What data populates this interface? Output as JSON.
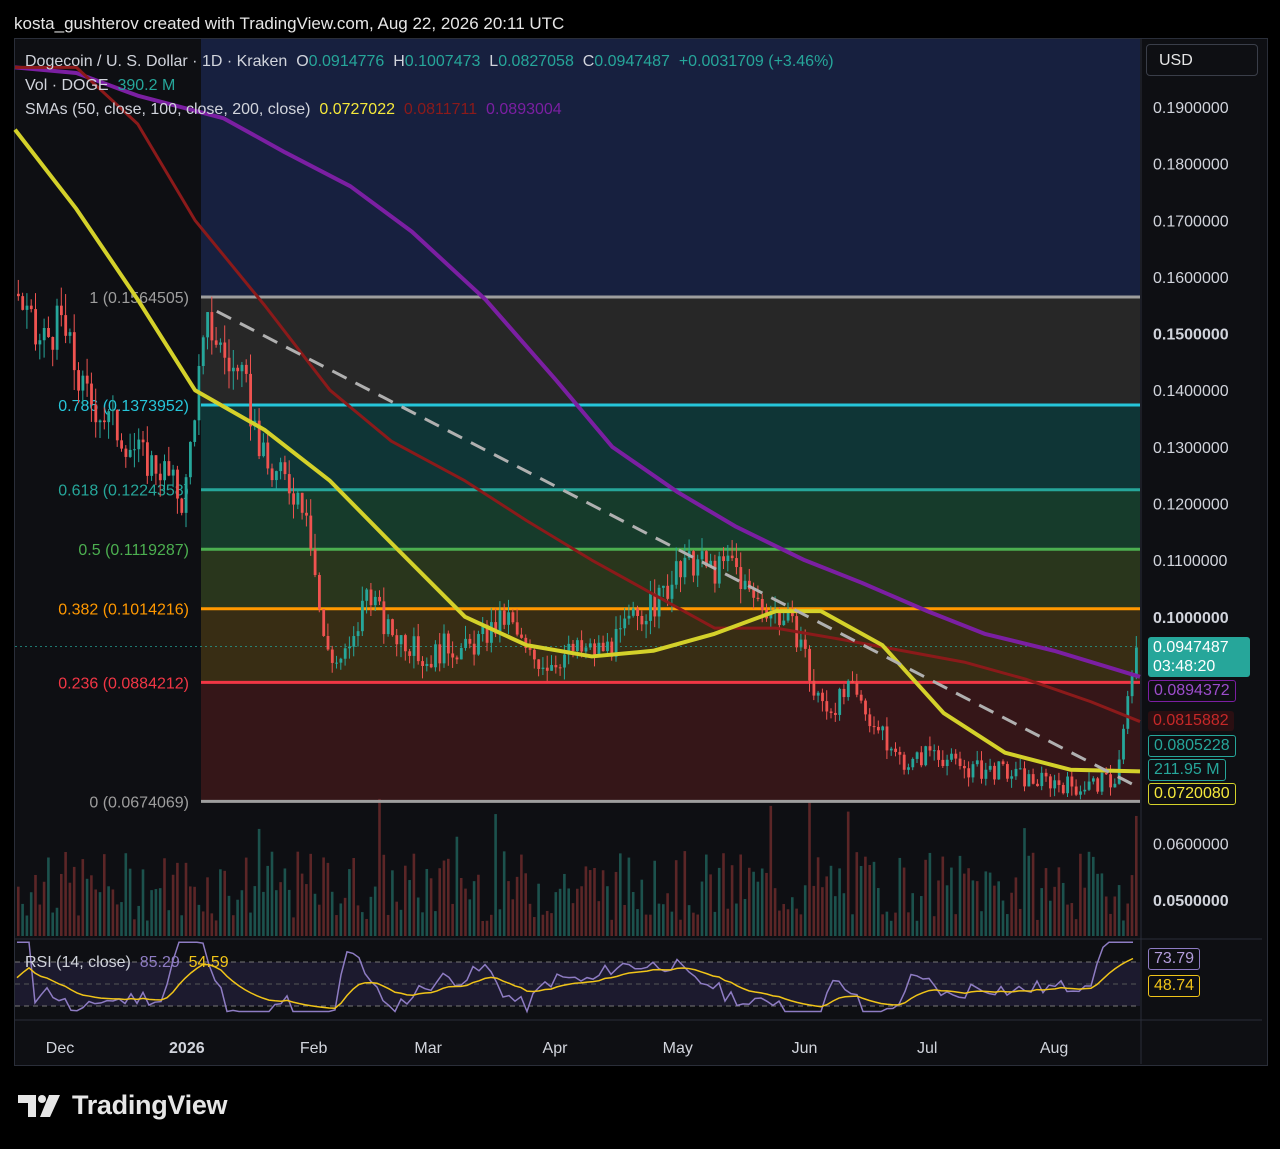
{
  "credit": "kosta_gushterov created with TradingView.com, Aug 22, 2026 20:11 UTC",
  "legend": {
    "symbol": "Dogecoin / U. S. Dollar · 1D · Kraken",
    "open_label": "O",
    "open": "0.0914776",
    "high_label": "H",
    "high": "0.1007473",
    "low_label": "L",
    "low": "0.0827058",
    "close_label": "C",
    "close": "0.0947487",
    "change": "+0.0031709 (+3.46%)",
    "vol_label": "Vol · DOGE",
    "vol": "390.2 M",
    "sma_label": "SMAs (50, close, 100, close, 200, close)",
    "sma50": "0.0727022",
    "sma100": "0.0811711",
    "sma200": "0.0893004"
  },
  "currency": "USD",
  "labels": {
    "current_price": "0.0947487",
    "countdown": "03:48:20",
    "sma200_tag": "0.0894372",
    "sma100_tag": "0.0815882",
    "level_tag": "0.0805228",
    "volume_tag": "211.95 M",
    "sma50_tag": "0.0720080"
  },
  "rsi": {
    "title": "RSI (14, close)",
    "value": "85.29",
    "ma": "54.59",
    "tag1": "73.79",
    "tag2": "48.74"
  },
  "brand": "TradingView",
  "colors": {
    "up": "#26a69a",
    "down": "#ef5350",
    "sma50": "#d4d12a",
    "sma100": "#8b1a1a",
    "sma200": "#7b1fa2",
    "rsi": "#8e7cc3",
    "rsi_ma": "#f0c419"
  },
  "chart_data": {
    "type": "candlestick",
    "symbol": "Dogecoin / U. S. Dollar",
    "interval": "1D",
    "exchange": "Kraken",
    "y_axis_ticks": [
      0.19,
      0.18,
      0.17,
      0.16,
      0.15,
      0.14,
      0.13,
      0.12,
      0.11,
      0.1,
      0.06,
      0.05
    ],
    "y_axis_tick_labels": [
      "0.1900000",
      "0.1800000",
      "0.1700000",
      "0.1600000",
      "0.1500000",
      "0.1400000",
      "0.1300000",
      "0.1200000",
      "0.1100000",
      "0.1000000",
      "0.0600000",
      "0.0500000"
    ],
    "x_axis_tick_labels": [
      "Dec",
      "2026",
      "Feb",
      "Mar",
      "Apr",
      "May",
      "Jun",
      "Jul",
      "Aug"
    ],
    "x_axis_ticks": [
      "2025-12-01",
      "2026-01-01",
      "2026-02-01",
      "2026-03-01",
      "2026-04-01",
      "2026-05-01",
      "2026-06-01",
      "2026-07-01",
      "2026-08-01"
    ],
    "ylim": [
      0.045,
      0.197
    ],
    "fib_levels": [
      {
        "ratio": "1",
        "price": 0.1564505,
        "label": "1 (0.1564505)",
        "color": "#9e9e9e"
      },
      {
        "ratio": "0.786",
        "price": 0.1373952,
        "label": "0.786 (0.1373952)",
        "color": "#26c6da"
      },
      {
        "ratio": "0.618",
        "price": 0.1224358,
        "label": "0.618 (0.1224358)",
        "color": "#26a69a"
      },
      {
        "ratio": "0.5",
        "price": 0.1119287,
        "label": "0.5 (0.1119287)",
        "color": "#4caf50"
      },
      {
        "ratio": "0.382",
        "price": 0.1014216,
        "label": "0.382 (0.1014216)",
        "color": "#ff9800"
      },
      {
        "ratio": "0.236",
        "price": 0.0884212,
        "label": "0.236 (0.0884212)",
        "color": "#f23645"
      },
      {
        "ratio": "0",
        "price": 0.0674069,
        "label": "0 (0.0674069)",
        "color": "#9e9e9e"
      }
    ],
    "price_series": {
      "name": "close",
      "x": [
        "2025-11-20",
        "2025-11-25",
        "2025-12-01",
        "2025-12-06",
        "2025-12-11",
        "2025-12-16",
        "2025-12-21",
        "2025-12-26",
        "2025-12-31",
        "2026-01-03",
        "2026-01-06",
        "2026-01-10",
        "2026-01-15",
        "2026-01-20",
        "2026-01-25",
        "2026-01-30",
        "2026-02-03",
        "2026-02-06",
        "2026-02-10",
        "2026-02-14",
        "2026-02-18",
        "2026-02-23",
        "2026-02-28",
        "2026-03-05",
        "2026-03-10",
        "2026-03-15",
        "2026-03-20",
        "2026-03-25",
        "2026-03-30",
        "2026-04-05",
        "2026-04-10",
        "2026-04-15",
        "2026-04-20",
        "2026-04-25",
        "2026-04-30",
        "2026-05-05",
        "2026-05-10",
        "2026-05-14",
        "2026-05-18",
        "2026-05-22",
        "2026-05-26",
        "2026-05-31",
        "2026-06-03",
        "2026-06-07",
        "2026-06-12",
        "2026-06-17",
        "2026-06-22",
        "2026-06-27",
        "2026-07-02",
        "2026-07-07",
        "2026-07-12",
        "2026-07-17",
        "2026-07-22",
        "2026-07-27",
        "2026-08-01",
        "2026-08-06",
        "2026-08-11",
        "2026-08-16",
        "2026-08-20",
        "2026-08-22"
      ],
      "y": [
        0.158,
        0.148,
        0.152,
        0.14,
        0.136,
        0.132,
        0.128,
        0.126,
        0.12,
        0.14,
        0.152,
        0.146,
        0.14,
        0.126,
        0.124,
        0.12,
        0.096,
        0.092,
        0.094,
        0.106,
        0.098,
        0.096,
        0.092,
        0.095,
        0.094,
        0.097,
        0.1,
        0.093,
        0.092,
        0.094,
        0.094,
        0.095,
        0.1,
        0.102,
        0.107,
        0.11,
        0.108,
        0.11,
        0.104,
        0.102,
        0.1,
        0.096,
        0.086,
        0.084,
        0.087,
        0.082,
        0.076,
        0.074,
        0.077,
        0.074,
        0.073,
        0.073,
        0.072,
        0.071,
        0.071,
        0.07,
        0.0705,
        0.0715,
        0.0915,
        0.0947
      ]
    },
    "sma50": {
      "name": "SMA 50",
      "value": 0.0727022,
      "x": [
        "2025-11-20",
        "2025-12-05",
        "2025-12-20",
        "2026-01-03",
        "2026-01-20",
        "2026-02-05",
        "2026-02-20",
        "2026-03-10",
        "2026-03-25",
        "2026-04-10",
        "2026-04-25",
        "2026-05-10",
        "2026-05-25",
        "2026-06-05",
        "2026-06-20",
        "2026-07-05",
        "2026-07-20",
        "2026-08-05",
        "2026-08-22"
      ],
      "y": [
        0.186,
        0.172,
        0.156,
        0.14,
        0.133,
        0.124,
        0.113,
        0.1,
        0.095,
        0.093,
        0.094,
        0.097,
        0.101,
        0.101,
        0.095,
        0.083,
        0.076,
        0.073,
        0.0727
      ]
    },
    "sma100": {
      "name": "SMA 100",
      "value": 0.0811711,
      "x": [
        "2025-11-20",
        "2025-12-05",
        "2025-12-20",
        "2026-01-03",
        "2026-01-20",
        "2026-02-05",
        "2026-02-20",
        "2026-03-10",
        "2026-03-25",
        "2026-04-10",
        "2026-04-25",
        "2026-05-10",
        "2026-05-25",
        "2026-06-10",
        "2026-06-25",
        "2026-07-10",
        "2026-07-25",
        "2026-08-10",
        "2026-08-22"
      ],
      "y": [
        0.197,
        0.197,
        0.187,
        0.17,
        0.155,
        0.14,
        0.131,
        0.124,
        0.117,
        0.11,
        0.104,
        0.098,
        0.098,
        0.096,
        0.094,
        0.092,
        0.089,
        0.085,
        0.0815
      ]
    },
    "sma200": {
      "name": "SMA 200",
      "value": 0.0893004,
      "x": [
        "2025-11-20",
        "2025-12-05",
        "2025-12-20",
        "2026-01-10",
        "2026-01-25",
        "2026-02-10",
        "2026-02-25",
        "2026-03-15",
        "2026-04-01",
        "2026-04-15",
        "2026-05-01",
        "2026-05-15",
        "2026-06-01",
        "2026-06-15",
        "2026-07-01",
        "2026-07-15",
        "2026-08-01",
        "2026-08-22"
      ],
      "y": [
        0.197,
        0.196,
        0.192,
        0.188,
        0.182,
        0.176,
        0.168,
        0.156,
        0.142,
        0.13,
        0.122,
        0.116,
        0.11,
        0.106,
        0.101,
        0.097,
        0.094,
        0.0894
      ]
    },
    "trendline": {
      "x": [
        "2026-01-01",
        "2026-08-20"
      ],
      "y": [
        0.1564,
        0.0705
      ],
      "style": "dashed"
    },
    "rsi": {
      "name": "RSI (14, close)",
      "value": 85.29,
      "ma_value": 54.59
    }
  }
}
